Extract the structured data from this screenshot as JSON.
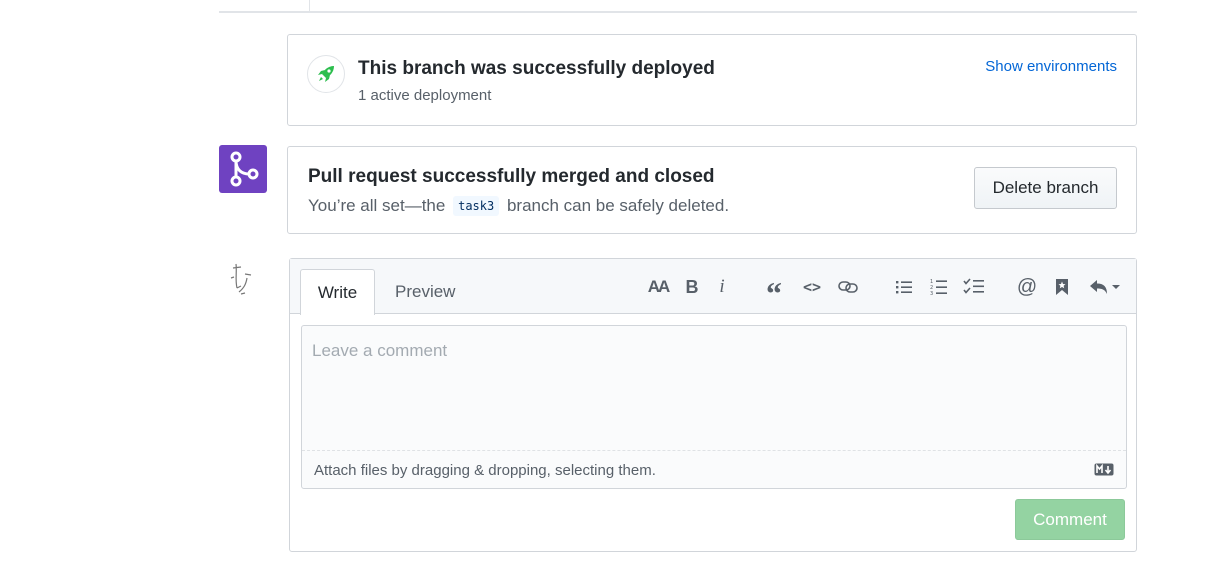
{
  "deployment": {
    "title": "This branch was successfully deployed",
    "subtitle": "1 active deployment",
    "link": "Show environments"
  },
  "merge": {
    "title": "Pull request successfully merged and closed",
    "subtitle_before": "You’re all set—the",
    "branch": "task3",
    "subtitle_after": "branch can be safely deleted.",
    "delete_button": "Delete branch"
  },
  "comment": {
    "tabs": {
      "write": "Write",
      "preview": "Preview"
    },
    "toolbar": [
      "header-icon",
      "bold-icon",
      "italic-icon",
      "quote-icon",
      "code-icon",
      "link-icon",
      "bulleted-list-icon",
      "numbered-list-icon",
      "task-list-icon",
      "mention-icon",
      "saved-reply-icon",
      "reply-icon"
    ],
    "toolbar_glyphs": {
      "header": "AA",
      "bold": "B",
      "italic": "i",
      "quote": "“",
      "code": "<>",
      "mention": "@"
    },
    "placeholder": "Leave a comment",
    "attach_text": "Attach files by dragging & dropping, selecting them.",
    "markdown_badge": "M↓",
    "submit": "Comment"
  },
  "colors": {
    "merged_purple": "#6f42c1",
    "link_blue": "#0366d6",
    "rocket_green": "#2cbe4e",
    "comment_button_disabled": "#94d3a2"
  }
}
